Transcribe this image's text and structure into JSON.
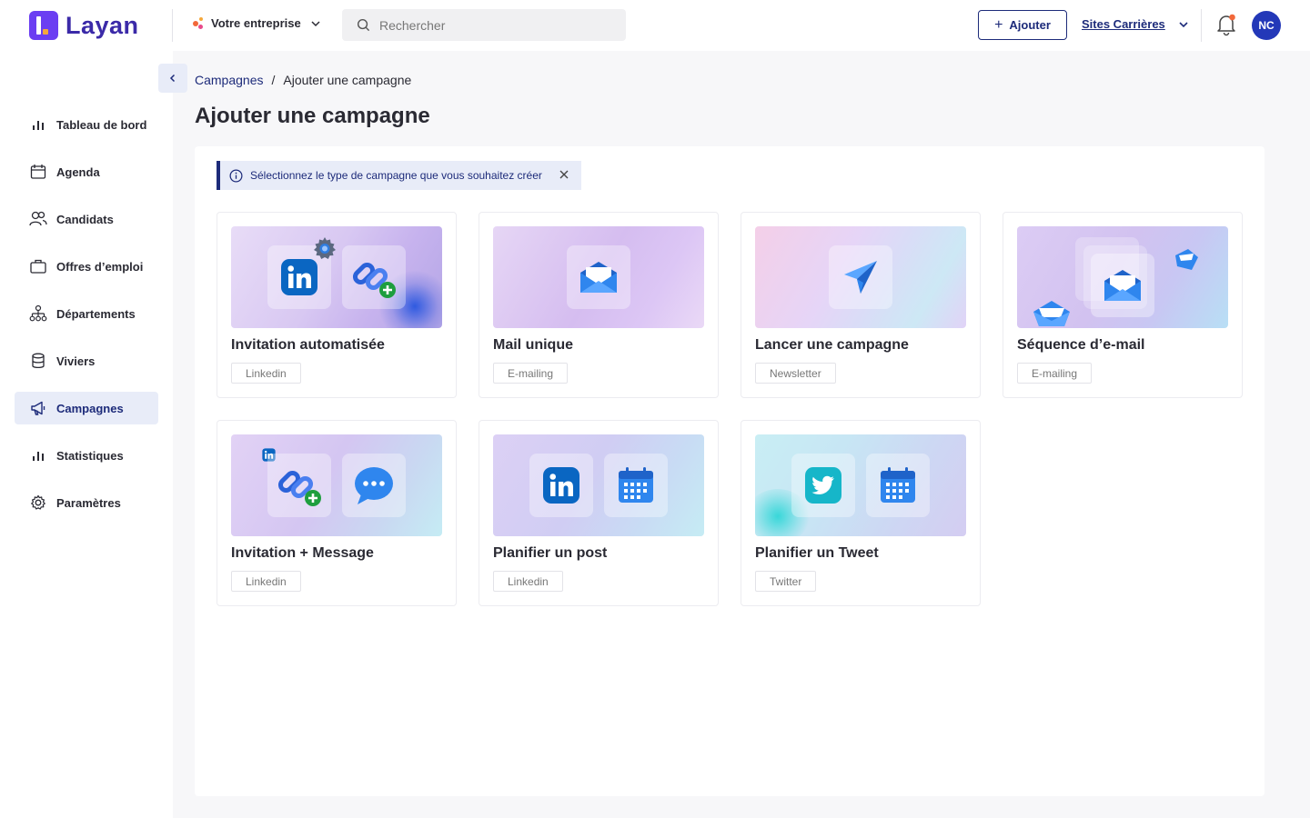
{
  "brand": {
    "name": "Layan",
    "color": "#6b3ef2"
  },
  "header": {
    "company": "Votre entreprise",
    "search_placeholder": "Rechercher",
    "add_label": "Ajouter",
    "sites_label": "Sites Carrières",
    "avatar_initials": "NC",
    "accent": "#1d2b7a"
  },
  "sidebar": {
    "items": [
      {
        "label": "Tableau de bord",
        "icon": "bar-chart-icon"
      },
      {
        "label": "Agenda",
        "icon": "calendar-icon"
      },
      {
        "label": "Candidats",
        "icon": "users-icon"
      },
      {
        "label": "Offres d’emploi",
        "icon": "briefcase-icon"
      },
      {
        "label": "Départements",
        "icon": "org-chart-icon"
      },
      {
        "label": "Viviers",
        "icon": "database-icon"
      },
      {
        "label": "Campagnes",
        "icon": "megaphone-icon",
        "active": true
      },
      {
        "label": "Statistiques",
        "icon": "bar-chart-icon"
      },
      {
        "label": "Paramètres",
        "icon": "gear-icon"
      }
    ]
  },
  "breadcrumb": {
    "parent": "Campagnes",
    "separator": "/",
    "current": "Ajouter une campagne"
  },
  "page_title": "Ajouter une campagne",
  "alert": {
    "text": "Sélectionnez le type de campagne que vous souhaitez créer"
  },
  "cards": [
    {
      "title": "Invitation automatisée",
      "tag": "Linkedin",
      "icons": [
        "linkedin-icon",
        "link-add-icon",
        "gear-icon"
      ]
    },
    {
      "title": "Mail unique",
      "tag": "E-mailing",
      "icons": [
        "envelope-icon"
      ]
    },
    {
      "title": "Lancer une campagne",
      "tag": "Newsletter",
      "icons": [
        "paper-plane-icon"
      ]
    },
    {
      "title": "Séquence d’e-mail",
      "tag": "E-mailing",
      "icons": [
        "envelope-icon",
        "envelope-stack-icon"
      ]
    },
    {
      "title": "Invitation + Message",
      "tag": "Linkedin",
      "icons": [
        "link-add-icon",
        "chat-bubble-icon",
        "linkedin-icon"
      ]
    },
    {
      "title": "Planifier un post",
      "tag": "Linkedin",
      "icons": [
        "linkedin-icon",
        "calendar-icon"
      ]
    },
    {
      "title": "Planifier un Tweet",
      "tag": "Twitter",
      "icons": [
        "twitter-icon",
        "calendar-icon"
      ]
    }
  ]
}
